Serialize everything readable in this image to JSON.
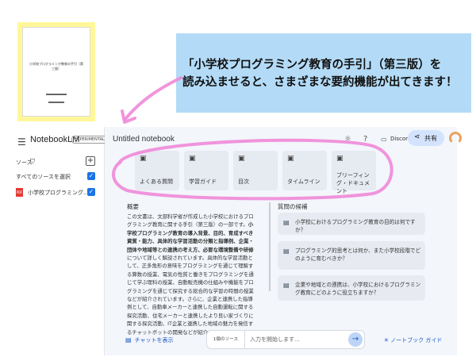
{
  "thumbnail": {
    "doc_title": "小学校プログラミング教育の手引（第三版）"
  },
  "callout": {
    "line1": "「小学校プログラミング教育の手引」（第三版）を",
    "line2": "読み込ませると、さまざまな要約機能が出てきます！",
    "bg_color": "#b3dbf7"
  },
  "highlight_colors": {
    "thumbnail_border": "#fff79a",
    "marker": "#f08ad8"
  },
  "sidebar": {
    "brand": "NotebookLM",
    "badge": "EXPERIMENTAL",
    "source_label": "ソース",
    "select_all": "すべてのソースを選択",
    "source_name": "小学校プログラミング..."
  },
  "header": {
    "notebook_title": "Untitled notebook",
    "discord": "Discord",
    "share": "共有"
  },
  "cards": [
    {
      "label": "よくある質問",
      "icon": "doc-icon"
    },
    {
      "label": "学習ガイド",
      "icon": "doc-icon"
    },
    {
      "label": "目次",
      "icon": "doc-icon"
    },
    {
      "label": "タイムライン",
      "icon": "doc-icon"
    },
    {
      "label": "ブリーフィング・ドキュメント",
      "icon": "doc-icon"
    }
  ],
  "summary": {
    "title": "概要",
    "part1": "この文書は、文部科学省が作成した小学校におけるプログラミング教育に関する手引（第三版）の一部です。",
    "bold1": "小学校プログラミング教育の導入背景、目的、育成すべき資質・能力、具体的な学習活動の分類と指導例、企業・団体や地域等との連携の考え方、必要な環境整備や研修",
    "part2": "について詳しく解説されています。具体的な学習活動として、正多角形の意味をプログラミングを通じて理解する算数の授業、電気の性質と働きをプログラミングを通じて学ぶ理科の授業、自動販売機の仕組みや機能をプログラミングを通じて探究する総合的な学習の時間の授業などが紹介されています。さらに、企業と連携した指導例として、自動車メーカーと連携した自動運転に関する探究活動、住宅メーカーと連携したより良い家づくりに関する探究活動、IT企業と連携した地域の魅力を発信するチャットボットの開発などが紹介されています。"
  },
  "questions": {
    "title": "質問の候補",
    "items": [
      "小学校におけるプログラミング教育の目的は何ですか？",
      "プログラミング的思考とは何か、また小学校段階でどのように育むべきか？",
      "企業や地域との連携は、小学校におけるプログラミング教育にどのように役立ちますか？"
    ]
  },
  "bottom": {
    "chat_toggle": "チャットを表示",
    "source_count": "1個のソース",
    "input_placeholder": "入力を開始します...",
    "guide": "ノートブック ガイド"
  }
}
